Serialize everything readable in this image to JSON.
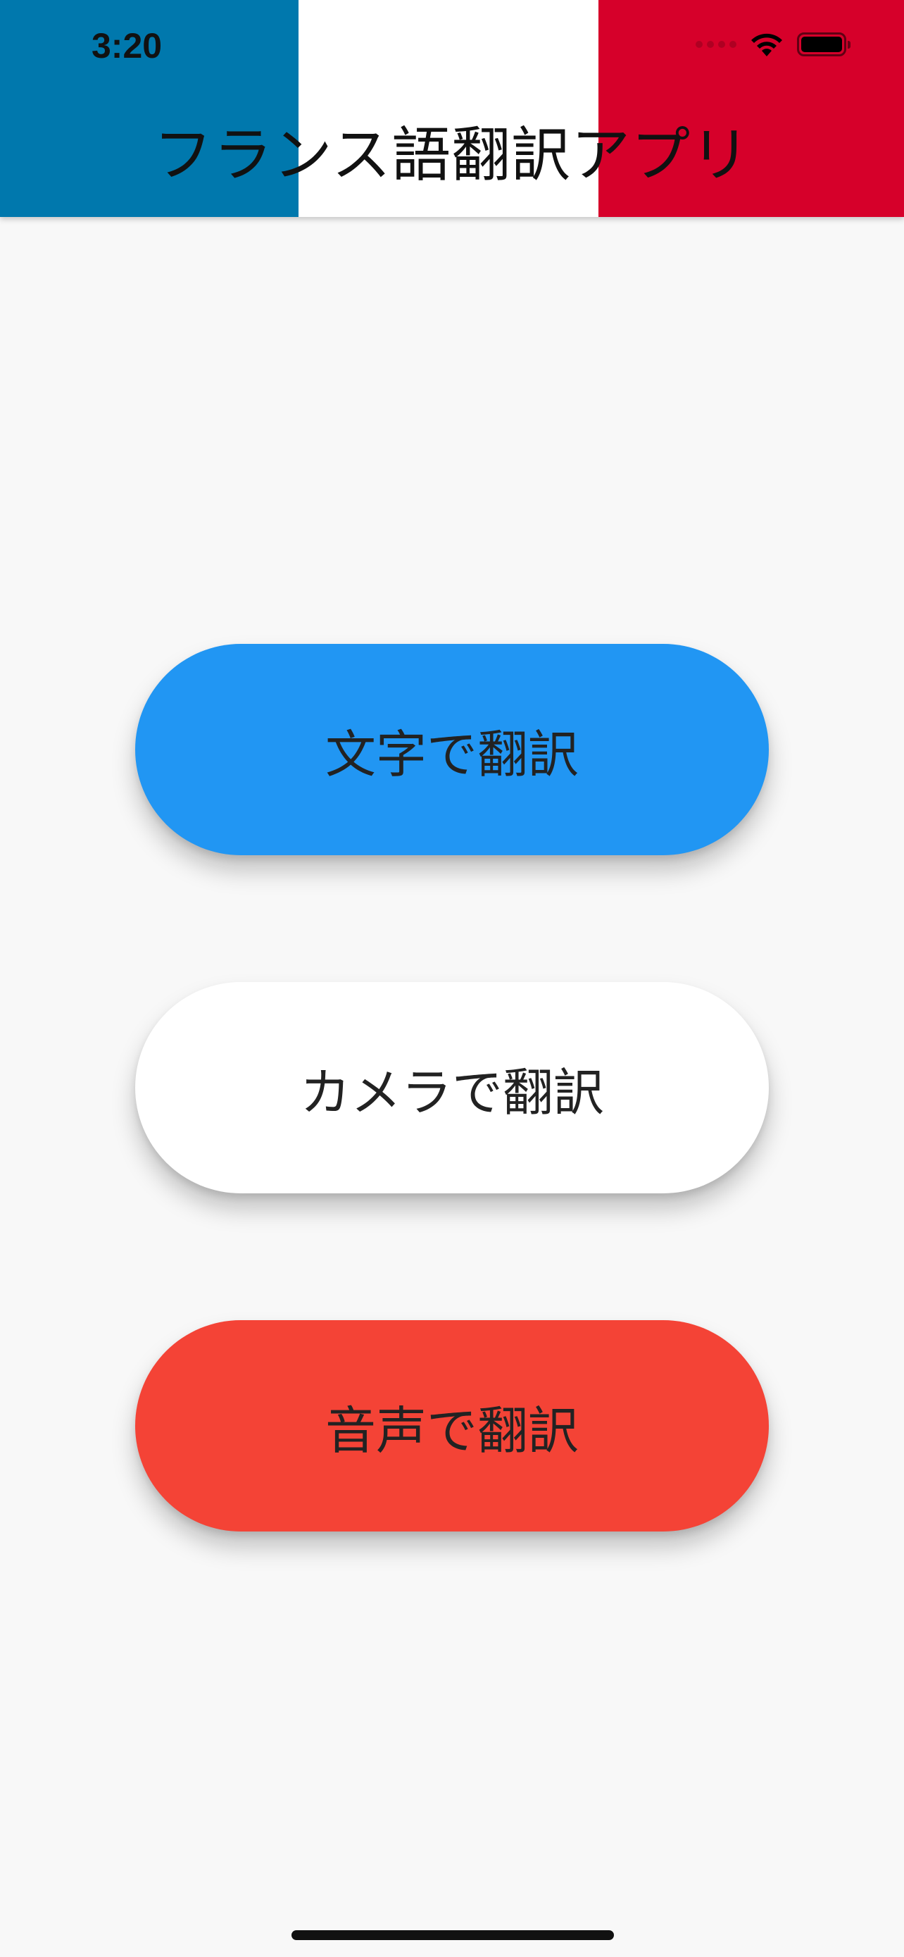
{
  "status_bar": {
    "time": "3:20",
    "wifi_icon": "wifi-icon",
    "battery_icon": "battery-icon",
    "signal_icon": "cellular-signal-icon"
  },
  "header": {
    "title": "フランス語翻訳アプリ",
    "flag_colors": [
      "#0078ad",
      "#ffffff",
      "#d6002a"
    ]
  },
  "buttons": {
    "text_translate": {
      "label": "文字で翻訳",
      "color": "#2196f3"
    },
    "camera_translate": {
      "label": "カメラで翻訳",
      "color": "#ffffff"
    },
    "voice_translate": {
      "label": "音声で翻訳",
      "color": "#f44336"
    }
  },
  "background_color": "#f8f8f8"
}
